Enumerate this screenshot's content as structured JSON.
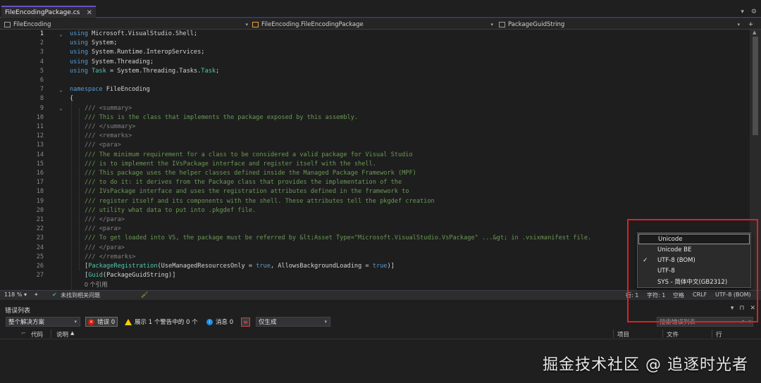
{
  "tab": {
    "title": "FileEncodingPackage.cs",
    "close": "✕"
  },
  "tabbar_right": {
    "dropdown": "▾",
    "settings": "⚙"
  },
  "navbar": {
    "project": "FileEncoding",
    "class": "FileEncoding.FileEncodingPackage",
    "member": "PackageGuidString",
    "expand": "+"
  },
  "editor": {
    "line_numbers": [
      "1",
      "2",
      "3",
      "4",
      "5",
      "6",
      "7",
      "8",
      "9",
      "10",
      "11",
      "12",
      "13",
      "14",
      "15",
      "16",
      "17",
      "18",
      "19",
      "20",
      "21",
      "22",
      "23",
      "24",
      "25",
      "26",
      "27"
    ],
    "code": {
      "l1": [
        "using",
        " Microsoft.VisualStudio.Shell;"
      ],
      "l2": [
        "using",
        " System;"
      ],
      "l3": [
        "using",
        " System.Runtime.InteropServices;"
      ],
      "l4": [
        "using",
        " System.Threading;"
      ],
      "l5": [
        "using",
        " ",
        "Task",
        " = System.Threading.Tasks.",
        "Task",
        ";"
      ],
      "l7": [
        "namespace",
        " FileEncoding"
      ],
      "l8": "{",
      "l9": [
        "/// ",
        "<summary>"
      ],
      "l10": "/// This is the class that implements the package exposed by this assembly.",
      "l11": [
        "/// ",
        "</summary>"
      ],
      "l12": [
        "/// ",
        "<remarks>"
      ],
      "l13": [
        "/// ",
        "<para>"
      ],
      "l14": "/// The minimum requirement for a class to be considered a valid package for Visual Studio",
      "l15": "/// is to implement the IVsPackage interface and register itself with the shell.",
      "l16": "/// This package uses the helper classes defined inside the Managed Package Framework (MPF)",
      "l17": "/// to do it: it derives from the Package class that provides the implementation of the",
      "l18": "/// IVsPackage interface and uses the registration attributes defined in the framework to",
      "l19": "/// register itself and its components with the shell. These attributes tell the pkgdef creation",
      "l20": "/// utility what data to put into .pkgdef file.",
      "l21": [
        "/// ",
        "</para>"
      ],
      "l22": [
        "/// ",
        "<para>"
      ],
      "l23": "/// To get loaded into VS, the package must be referred by &lt;Asset Type=\"Microsoft.VisualStudio.VsPackage\" ...&gt; in .vsixmanifest file.",
      "l24": [
        "/// ",
        "</para>"
      ],
      "l25": [
        "/// ",
        "</remarks>"
      ],
      "l26": [
        "[",
        "PackageRegistration",
        "(UseManagedResourcesOnly = ",
        "true",
        ", AllowsBackgroundLoading = ",
        "true",
        ")]"
      ],
      "l27": [
        "[",
        "Guid",
        "(PackageGuidString)]"
      ],
      "refs": "0 个引用"
    }
  },
  "editor_status": {
    "zoom": "118 %",
    "zoom_dd": "▾",
    "issues": "未找到相关问题",
    "line": "行: 1",
    "char": "字符: 1",
    "whitespace": "空格",
    "eol": "CRLF",
    "encoding": "UTF-8 (BOM)"
  },
  "encoding_menu": {
    "items": [
      "Unicode",
      "Unicode BE",
      "UTF-8 (BOM)",
      "UTF-8",
      "SYS - 简体中文(GB2312)"
    ],
    "checked": "✓"
  },
  "error_list": {
    "title": "错误列表",
    "title_icons": [
      "▾",
      "⊓",
      "✕"
    ],
    "scope": "整个解决方案",
    "errors": "错误 0",
    "warnings": "展示 1 个警告中的 0 个",
    "messages": "消息 0",
    "build_filter": "仅生成",
    "search_placeholder": "搜索错误列表",
    "columns": {
      "code": "代码",
      "desc": "说明",
      "project": "项目",
      "file": "文件",
      "line": "行"
    }
  },
  "watermark": "掘金技术社区 @ 追逐时光者",
  "colors": {
    "keyword": "#569cd6",
    "type": "#4ec9b0",
    "comment": "#6a9955",
    "highlight_border": "#e02020",
    "tab_accent": "#6a4fc4"
  }
}
